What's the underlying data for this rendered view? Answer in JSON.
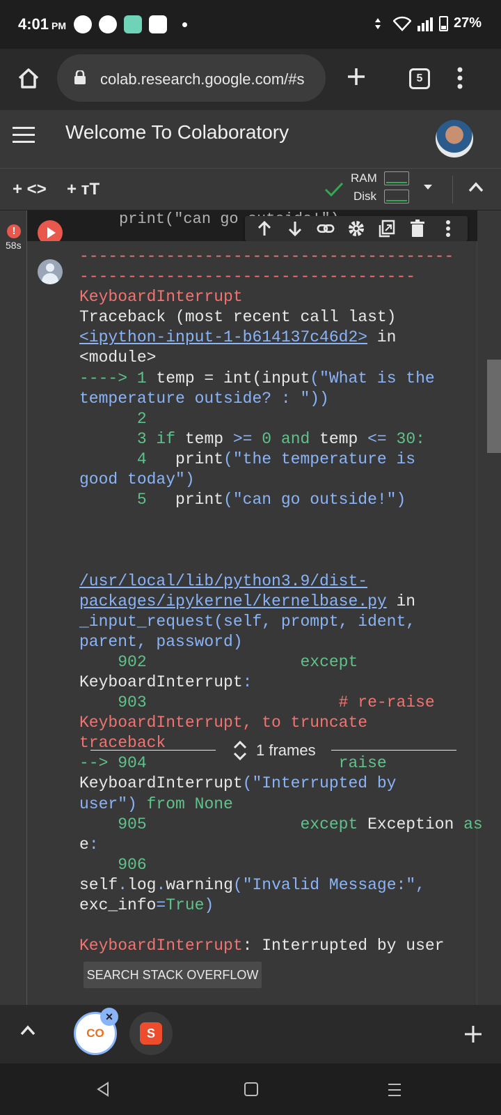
{
  "status_bar": {
    "time": "4:01",
    "ampm": "PM",
    "battery": "27%"
  },
  "browser": {
    "url": "colab.research.google.com/#s",
    "tab_count": "5"
  },
  "colab": {
    "title": "Welcome To Colaboratory",
    "toolbar": {
      "add_code": "+ <>",
      "add_text": "+ тT",
      "ram_label": "RAM",
      "disk_label": "Disk"
    }
  },
  "cell": {
    "exec_time": "58s",
    "code_line": "print(\"can go outside!\")"
  },
  "output": {
    "frames_label": "1 frames",
    "search_button": "SEARCH STACK OVERFLOW",
    "lines": [
      [
        {
          "t": "---------------------------------------",
          "c": "red"
        }
      ],
      [
        {
          "t": "-----------------------------------",
          "c": "red"
        }
      ],
      [
        {
          "t": "KeyboardInterrupt",
          "c": "red"
        }
      ],
      [
        {
          "t": "Traceback (most recent call last)",
          "c": "white"
        }
      ],
      [
        {
          "t": "<ipython-input-1-b614137c46d2>",
          "c": "link"
        },
        {
          "t": " in",
          "c": "white"
        }
      ],
      [
        {
          "t": "<module>",
          "c": "white"
        }
      ],
      [
        {
          "t": "----> 1 ",
          "c": "green"
        },
        {
          "t": "temp = int",
          "c": "white"
        },
        {
          "t": "(",
          "c": "white"
        },
        {
          "t": "input",
          "c": "white"
        },
        {
          "t": "(\"What is the",
          "c": "blue"
        }
      ],
      [
        {
          "t": "temperature outside? : \"))",
          "c": "blue"
        }
      ],
      [
        {
          "t": "      2",
          "c": "green"
        }
      ],
      [
        {
          "t": "      3 ",
          "c": "green"
        },
        {
          "t": "if ",
          "c": "green"
        },
        {
          "t": "temp ",
          "c": "white"
        },
        {
          "t": ">= ",
          "c": "blue"
        },
        {
          "t": "0 ",
          "c": "green"
        },
        {
          "t": "and ",
          "c": "green"
        },
        {
          "t": "temp ",
          "c": "white"
        },
        {
          "t": "<= ",
          "c": "blue"
        },
        {
          "t": "30:",
          "c": "green"
        }
      ],
      [
        {
          "t": "      4   ",
          "c": "green"
        },
        {
          "t": "print",
          "c": "white"
        },
        {
          "t": "(\"the temperature is",
          "c": "blue"
        }
      ],
      [
        {
          "t": "good today\")",
          "c": "blue"
        }
      ],
      [
        {
          "t": "      5   ",
          "c": "green"
        },
        {
          "t": "print",
          "c": "white"
        },
        {
          "t": "(\"can go outside!\")",
          "c": "blue"
        }
      ],
      [
        {
          "t": "",
          "c": "white"
        }
      ],
      [
        {
          "t": "",
          "c": "white"
        }
      ],
      [
        {
          "t": "",
          "c": "white"
        }
      ],
      [
        {
          "t": "/usr/local/lib/python3.9/dist-",
          "c": "link"
        }
      ],
      [
        {
          "t": "packages/ipykernel/kernelbase.py",
          "c": "link"
        },
        {
          "t": " in",
          "c": "white"
        }
      ],
      [
        {
          "t": "_input_request(self, prompt, ident,",
          "c": "blue"
        }
      ],
      [
        {
          "t": "parent, password)",
          "c": "blue"
        }
      ],
      [
        {
          "t": "    902",
          "c": "green"
        },
        {
          "t": "                ",
          "c": "white"
        },
        {
          "t": "except",
          "c": "green"
        }
      ],
      [
        {
          "t": "KeyboardInterrupt",
          "c": "white"
        },
        {
          "t": ":",
          "c": "blue"
        }
      ],
      [
        {
          "t": "    903",
          "c": "green"
        },
        {
          "t": "                    ",
          "c": "white"
        },
        {
          "t": "# re-raise",
          "c": "red"
        }
      ],
      [
        {
          "t": "KeyboardInterrupt, to truncate",
          "c": "red"
        }
      ],
      [
        {
          "t": "traceback",
          "c": "red"
        }
      ],
      [
        {
          "t": "--> 904",
          "c": "green"
        },
        {
          "t": "                    ",
          "c": "white"
        },
        {
          "t": "raise",
          "c": "green"
        }
      ],
      [
        {
          "t": "KeyboardInterrupt",
          "c": "white"
        },
        {
          "t": "(\"Interrupted by",
          "c": "blue"
        }
      ],
      [
        {
          "t": "user\") ",
          "c": "blue"
        },
        {
          "t": "from None",
          "c": "green"
        }
      ],
      [
        {
          "t": "    905",
          "c": "green"
        },
        {
          "t": "                ",
          "c": "white"
        },
        {
          "t": "except ",
          "c": "green"
        },
        {
          "t": "Exception ",
          "c": "white"
        },
        {
          "t": "as",
          "c": "green"
        }
      ],
      [
        {
          "t": "e",
          "c": "white"
        },
        {
          "t": ":",
          "c": "blue"
        }
      ],
      [
        {
          "t": "    906",
          "c": "green"
        }
      ],
      [
        {
          "t": "self",
          "c": "white"
        },
        {
          "t": ".",
          "c": "blue"
        },
        {
          "t": "log",
          "c": "white"
        },
        {
          "t": ".",
          "c": "blue"
        },
        {
          "t": "warning",
          "c": "white"
        },
        {
          "t": "(\"Invalid Message:\",",
          "c": "blue"
        }
      ],
      [
        {
          "t": "exc_info",
          "c": "white"
        },
        {
          "t": "=",
          "c": "blue"
        },
        {
          "t": "True",
          "c": "green"
        },
        {
          "t": ")",
          "c": "blue"
        }
      ],
      [
        {
          "t": "",
          "c": "white"
        }
      ],
      [
        {
          "t": "KeyboardInterrupt",
          "c": "red"
        },
        {
          "t": ": Interrupted by user",
          "c": "white"
        }
      ]
    ]
  },
  "icons": {
    "home": "home-icon",
    "lock": "lock-icon",
    "add_tab": "plus-icon",
    "menu": "more-vert-icon"
  }
}
